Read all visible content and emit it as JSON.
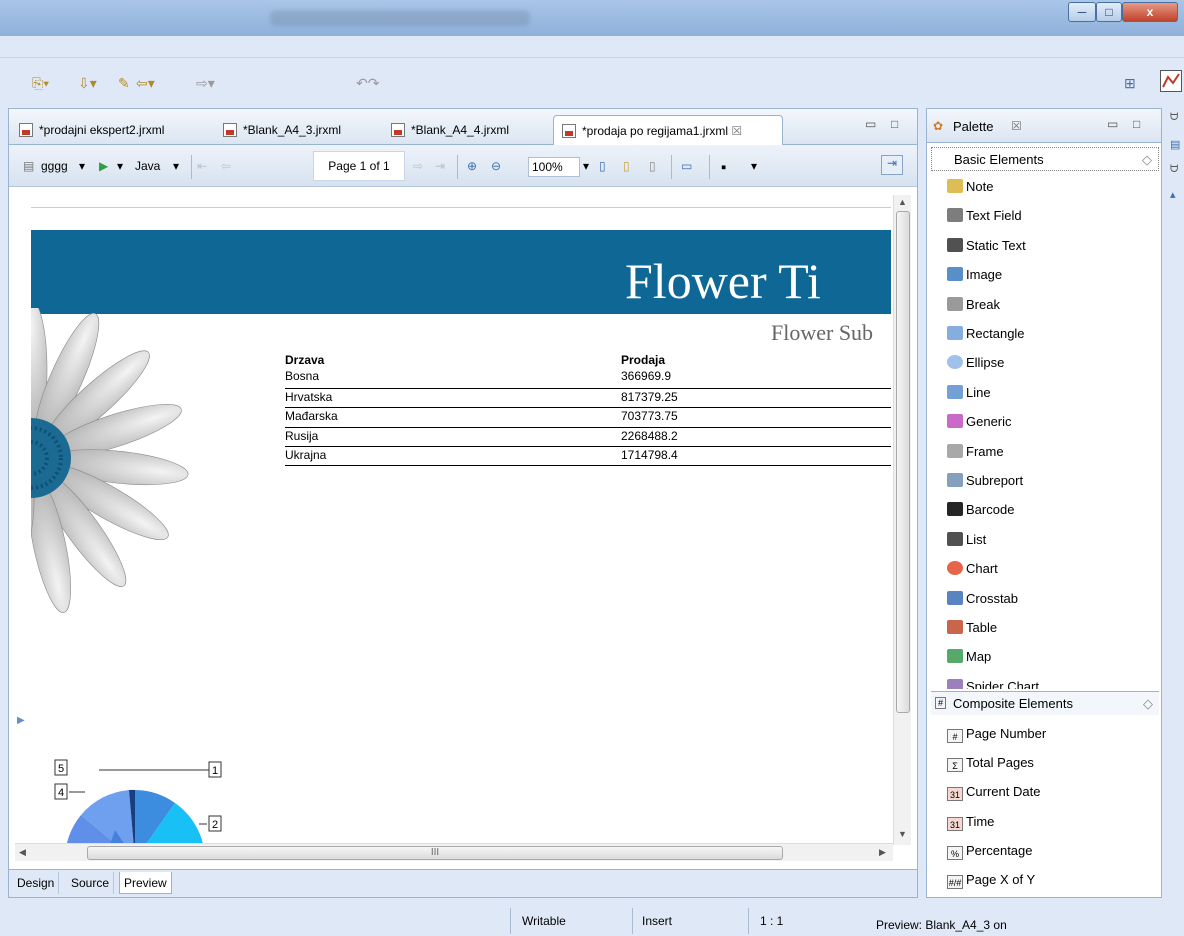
{
  "window": {
    "min_label": "─",
    "max_label": "□",
    "close_label": "x"
  },
  "editor": {
    "tabs": [
      {
        "label": "*prodajni ekspert2.jrxml"
      },
      {
        "label": "*Blank_A4_3.jrxml"
      },
      {
        "label": "*Blank_A4_4.jrxml"
      },
      {
        "label": "*prodaja po regijama1.jrxml",
        "close": "☒"
      }
    ],
    "preview_toolbar": {
      "dataset": "gggg",
      "language": "Java",
      "page": "Page 1 of 1",
      "zoom": "100%"
    },
    "bottom_tabs": [
      "Design",
      "Source",
      "Preview"
    ],
    "active_bottom_tab": "Preview"
  },
  "report": {
    "title": "Flower Ti",
    "subtitle": "Flower Sub",
    "columns": [
      "Drzava",
      "Prodaja"
    ],
    "rows": [
      [
        "Bosna",
        "366969.9"
      ],
      [
        "Hrvatska",
        "817379.25"
      ],
      [
        "Mađarska",
        "703773.75"
      ],
      [
        "Rusija",
        "2268488.2"
      ],
      [
        "Ukrajna",
        "1714798.4"
      ]
    ],
    "pie_labels": [
      "1",
      "2",
      "4",
      "5"
    ],
    "scroll_thumb_label": "III"
  },
  "palette": {
    "title": "Palette",
    "close": "☒",
    "basic_section": "Basic Elements",
    "basic_items": [
      {
        "label": "Note",
        "icon": "note-icon",
        "color": "#d8b13a"
      },
      {
        "label": "Text Field",
        "icon": "text-field-icon",
        "color": "#666666"
      },
      {
        "label": "Static Text",
        "icon": "static-text-icon",
        "color": "#333333"
      },
      {
        "label": "Image",
        "icon": "image-icon",
        "color": "#3b7bbf"
      },
      {
        "label": "Break",
        "icon": "break-icon",
        "color": "#888888"
      },
      {
        "label": "Rectangle",
        "icon": "rectangle-icon",
        "color": "#6fa0d8"
      },
      {
        "label": "Ellipse",
        "icon": "ellipse-icon",
        "color": "#8fb6e6"
      },
      {
        "label": "Line",
        "icon": "line-icon",
        "color": "#5a8fd0"
      },
      {
        "label": "Generic",
        "icon": "generic-icon",
        "color": "#c050c0"
      },
      {
        "label": "Frame",
        "icon": "frame-icon",
        "color": "#999999"
      },
      {
        "label": "Subreport",
        "icon": "subreport-icon",
        "color": "#6f8fb0"
      },
      {
        "label": "Barcode",
        "icon": "barcode-icon",
        "color": "#000000"
      },
      {
        "label": "List",
        "icon": "list-icon",
        "color": "#333333"
      },
      {
        "label": "Chart",
        "icon": "chart-icon",
        "color": "#e04a2a"
      },
      {
        "label": "Crosstab",
        "icon": "crosstab-icon",
        "color": "#3b6fb5"
      },
      {
        "label": "Table",
        "icon": "table-icon",
        "color": "#c04a2a"
      },
      {
        "label": "Map",
        "icon": "map-icon",
        "color": "#3a9a50"
      },
      {
        "label": "Spider Chart",
        "icon": "spider-chart-icon",
        "color": "#8a6ab0"
      }
    ],
    "composite_section": "Composite Elements",
    "composite_items": [
      {
        "label": "Page Number",
        "glyph": "#"
      },
      {
        "label": "Total Pages",
        "glyph": "Σ"
      },
      {
        "label": "Current Date",
        "glyph": "31"
      },
      {
        "label": "Time",
        "glyph": "31"
      },
      {
        "label": "Percentage",
        "glyph": "%"
      },
      {
        "label": "Page X of Y",
        "glyph": "#/#"
      }
    ],
    "section_toggle": "◇"
  },
  "status": {
    "writable": "Writable",
    "insert": "Insert",
    "position": "1 : 1",
    "preview": "Preview: Blank_A4_3 on"
  },
  "colors": {
    "banner": "#0f6796",
    "accent": "#3b7bbf"
  }
}
